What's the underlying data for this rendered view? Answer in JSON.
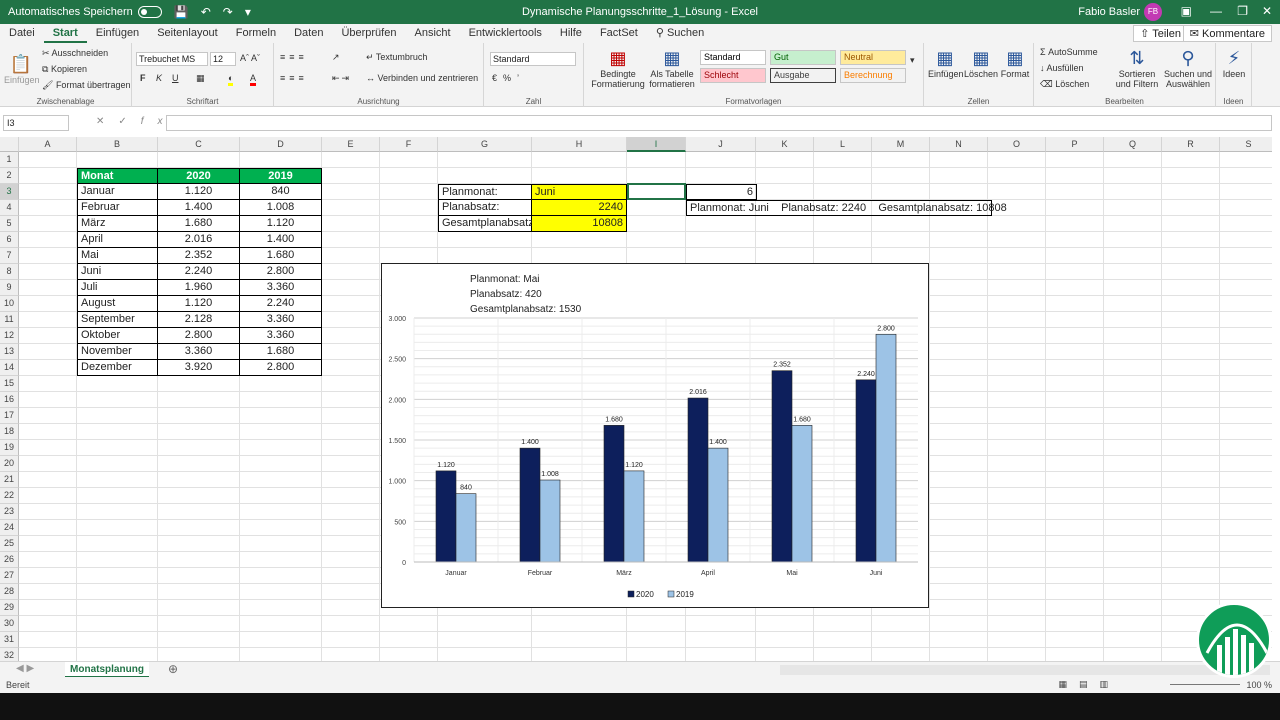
{
  "titlebar": {
    "autosave_label": "Automatisches Speichern",
    "doc_title": "Dynamische Planungsschritte_1_Lösung - Excel",
    "user": "Fabio Basler",
    "initials": "FB"
  },
  "menu": {
    "tabs": [
      "Datei",
      "Start",
      "Einfügen",
      "Seitenlayout",
      "Formeln",
      "Daten",
      "Überprüfen",
      "Ansicht",
      "Entwicklertools",
      "Hilfe",
      "FactSet",
      "Suchen"
    ],
    "active": "Start",
    "share": "Teilen",
    "comments": "Kommentare"
  },
  "ribbon": {
    "clipboard": {
      "label": "Zwischenablage",
      "paste": "Einfügen",
      "cut": "Ausschneiden",
      "copy": "Kopieren",
      "format_painter": "Format übertragen"
    },
    "font": {
      "label": "Schriftart",
      "name": "Trebuchet MS",
      "size": "12"
    },
    "alignment": {
      "label": "Ausrichtung",
      "wrap": "Textumbruch",
      "merge": "Verbinden und zentrieren"
    },
    "number": {
      "label": "Zahl",
      "format": "Standard"
    },
    "styles": {
      "label": "Formatvorlagen",
      "cond": "Bedingte Formatierung",
      "table": "Als Tabelle formatieren",
      "boxes": [
        {
          "name": "Standard",
          "bg": "#ffffff",
          "fg": "#000000"
        },
        {
          "name": "Gut",
          "bg": "#c6efce",
          "fg": "#006100"
        },
        {
          "name": "Neutral",
          "bg": "#ffeb9c",
          "fg": "#9c5700"
        },
        {
          "name": "Schlecht",
          "bg": "#ffc7ce",
          "fg": "#9c0006"
        },
        {
          "name": "Ausgabe",
          "bg": "#f2f2f2",
          "fg": "#3f3f3f"
        },
        {
          "name": "Berechnung",
          "bg": "#f2f2f2",
          "fg": "#fa7d00"
        }
      ]
    },
    "cells": {
      "label": "Zellen",
      "insert": "Einfügen",
      "delete": "Löschen",
      "format": "Format"
    },
    "editing": {
      "label": "Bearbeiten",
      "autosum": "AutoSumme",
      "fill": "Ausfüllen",
      "clear": "Löschen",
      "sort": "Sortieren und Filtern",
      "find": "Suchen und Auswählen"
    },
    "ideas": {
      "label": "Ideen",
      "btn": "Ideen"
    }
  },
  "formula_bar": {
    "name_box": "I3",
    "formula": ""
  },
  "columns": [
    "A",
    "B",
    "C",
    "D",
    "E",
    "F",
    "G",
    "H",
    "I",
    "J",
    "K",
    "L",
    "M",
    "N",
    "O",
    "P",
    "Q",
    "R",
    "S"
  ],
  "rows": [
    "1",
    "2",
    "3",
    "4",
    "5",
    "6",
    "7",
    "8",
    "9",
    "10",
    "11",
    "12",
    "13",
    "14",
    "15",
    "16",
    "17",
    "18",
    "19",
    "20",
    "21",
    "22",
    "23",
    "24",
    "25",
    "26",
    "27",
    "28",
    "29",
    "30",
    "31",
    "32"
  ],
  "table": {
    "headers": [
      "Monat",
      "2020",
      "2019"
    ],
    "rows": [
      [
        "Januar",
        "1.120",
        "840"
      ],
      [
        "Februar",
        "1.400",
        "1.008"
      ],
      [
        "März",
        "1.680",
        "1.120"
      ],
      [
        "April",
        "2.016",
        "1.400"
      ],
      [
        "Mai",
        "2.352",
        "1.680"
      ],
      [
        "Juni",
        "2.240",
        "2.800"
      ],
      [
        "Juli",
        "1.960",
        "3.360"
      ],
      [
        "August",
        "1.120",
        "2.240"
      ],
      [
        "September",
        "2.128",
        "3.360"
      ],
      [
        "Oktober",
        "2.800",
        "3.360"
      ],
      [
        "November",
        "3.360",
        "1.680"
      ],
      [
        "Dezember",
        "3.920",
        "2.800"
      ]
    ]
  },
  "plan": {
    "labels": [
      "Planmonat:",
      "Planabsatz:",
      "Gesamtplanabsatz:"
    ],
    "values": [
      "Juni",
      "2240",
      "10808"
    ],
    "month_index": "6",
    "summary": "Planmonat: Juni    Planabsatz: 2240    Gesamtplanabsatz: 10808",
    "highlight": "#ffff00"
  },
  "chart_data": {
    "type": "bar",
    "annotation": [
      "Planmonat: Mai",
      "Planabsatz: 420",
      "Gesamtplanabsatz: 1530"
    ],
    "categories": [
      "Januar",
      "Februar",
      "März",
      "April",
      "Mai",
      "Juni"
    ],
    "series": [
      {
        "name": "2020",
        "values": [
          1120,
          1400,
          1680,
          2016,
          2352,
          2240
        ],
        "labels": [
          "1.120",
          "1.400",
          "1.680",
          "2.016",
          "2.352",
          "2.240"
        ],
        "color": "#0d1f5c"
      },
      {
        "name": "2019",
        "values": [
          840,
          1008,
          1120,
          1400,
          1680,
          2800
        ],
        "labels": [
          "840",
          "1.008",
          "1.120",
          "1.400",
          "1.680",
          "2.800"
        ],
        "color": "#9dc3e6"
      }
    ],
    "ylim": [
      0,
      3000
    ],
    "yticks": [
      "0",
      "500",
      "1.000",
      "1.500",
      "2.000",
      "2.500",
      "3.000"
    ],
    "legend": "bottom",
    "grid": true
  },
  "sheet": {
    "tab": "Monatsplanung"
  },
  "status": {
    "text": "Bereit",
    "zoom": "100 %"
  }
}
